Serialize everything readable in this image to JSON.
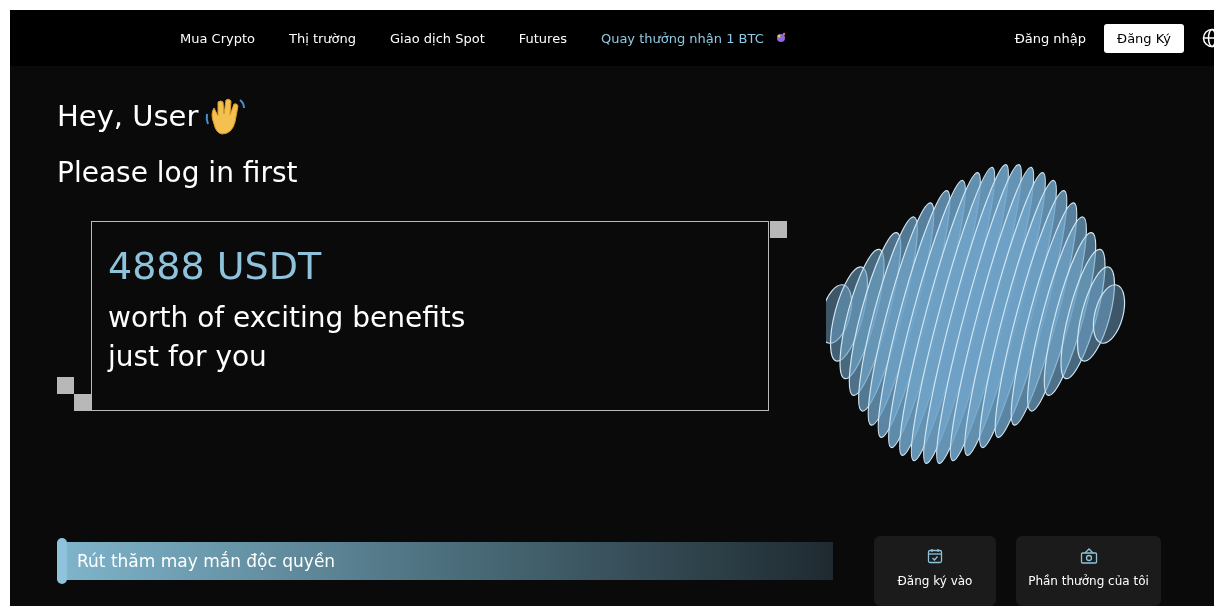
{
  "nav": {
    "items": [
      {
        "label": "Mua Crypto",
        "kind": "link"
      },
      {
        "label": "Thị trường",
        "kind": "link"
      },
      {
        "label": "Giao dịch Spot",
        "kind": "link"
      },
      {
        "label": "Futures",
        "kind": "link"
      },
      {
        "label": "Quay thưởng nhận 1 BTC",
        "kind": "promo"
      }
    ],
    "login": "Đăng nhập",
    "signup": "Đăng Ký"
  },
  "greeting": "Hey, User",
  "subtitle": "Please log in first",
  "promo": {
    "amount": "4888 USDT",
    "lines": [
      "worth of exciting benefits",
      "just for you"
    ]
  },
  "lucky_draw": {
    "title": "Rút thăm may mắn độc quyền"
  },
  "cards": [
    {
      "label": "Đăng ký vào",
      "kind": "calendar"
    },
    {
      "label": "Phần thưởng của tôi",
      "kind": "gift"
    }
  ]
}
